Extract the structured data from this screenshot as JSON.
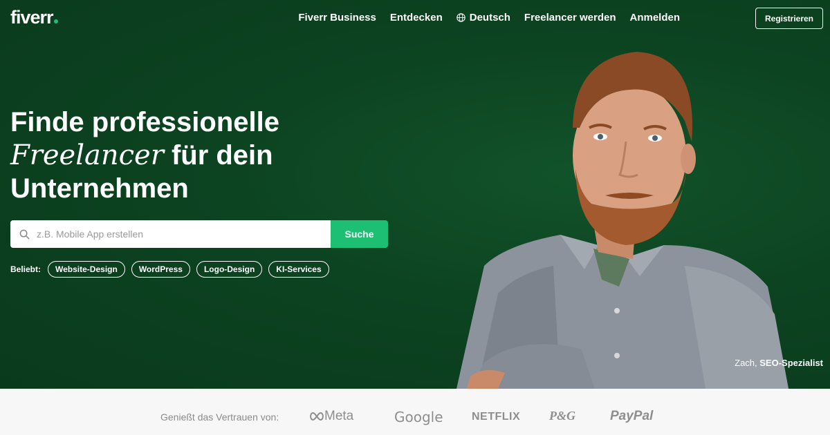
{
  "header": {
    "logo": "fiverr",
    "nav": [
      "Fiverr Business",
      "Entdecken",
      "Deutsch",
      "Freelancer werden",
      "Anmelden"
    ],
    "register": "Registrieren"
  },
  "hero": {
    "headline_line1": "Finde professionelle",
    "headline_italic": "Freelancer",
    "headline_line2_rest": " für dein",
    "headline_line3": "Unternehmen",
    "search_placeholder": "z.B. Mobile App erstellen",
    "search_button": "Suche",
    "popular_label": "Beliebt:",
    "popular": [
      "Website-Design",
      "WordPress",
      "Logo-Design",
      "KI-Services"
    ],
    "caption_name": "Zach, ",
    "caption_role": "SEO-Spezialist"
  },
  "trust": {
    "label": "Genießt das Vertrauen von:",
    "brands": [
      "Meta",
      "Google",
      "NETFLIX",
      "P&G",
      "PayPal"
    ]
  },
  "colors": {
    "hero_bg": "#0c4321",
    "accent": "#1dbf73"
  }
}
